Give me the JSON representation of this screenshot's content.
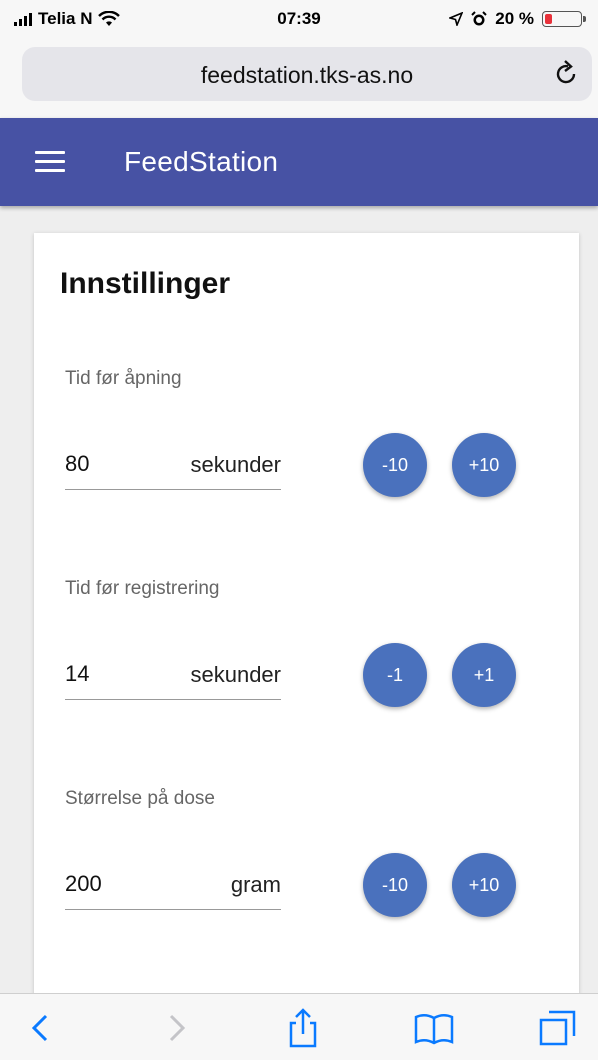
{
  "status_bar": {
    "carrier": "Telia N",
    "time": "07:39",
    "battery": "20 %",
    "battery_level": 0.2
  },
  "browser": {
    "url": "feedstation.tks-as.no"
  },
  "app_bar": {
    "title": "FeedStation"
  },
  "card": {
    "title": "Innstillinger",
    "settings": [
      {
        "label": "Tid før åpning",
        "value": "80",
        "unit": "sekunder",
        "decrement": "-10",
        "increment": "+10"
      },
      {
        "label": "Tid før registrering",
        "value": "14",
        "unit": "sekunder",
        "decrement": "-1",
        "increment": "+1"
      },
      {
        "label": "Størrelse på dose",
        "value": "200",
        "unit": "gram",
        "decrement": "-10",
        "increment": "+10"
      }
    ]
  },
  "colors": {
    "app_bar": "#4752a4",
    "fab": "#4a71bd",
    "ios_blue": "#0a7aff",
    "battery_low": "#e8313a"
  },
  "toolbar_icons": [
    "back-icon",
    "forward-icon",
    "share-icon",
    "bookmarks-icon",
    "tabs-icon"
  ]
}
